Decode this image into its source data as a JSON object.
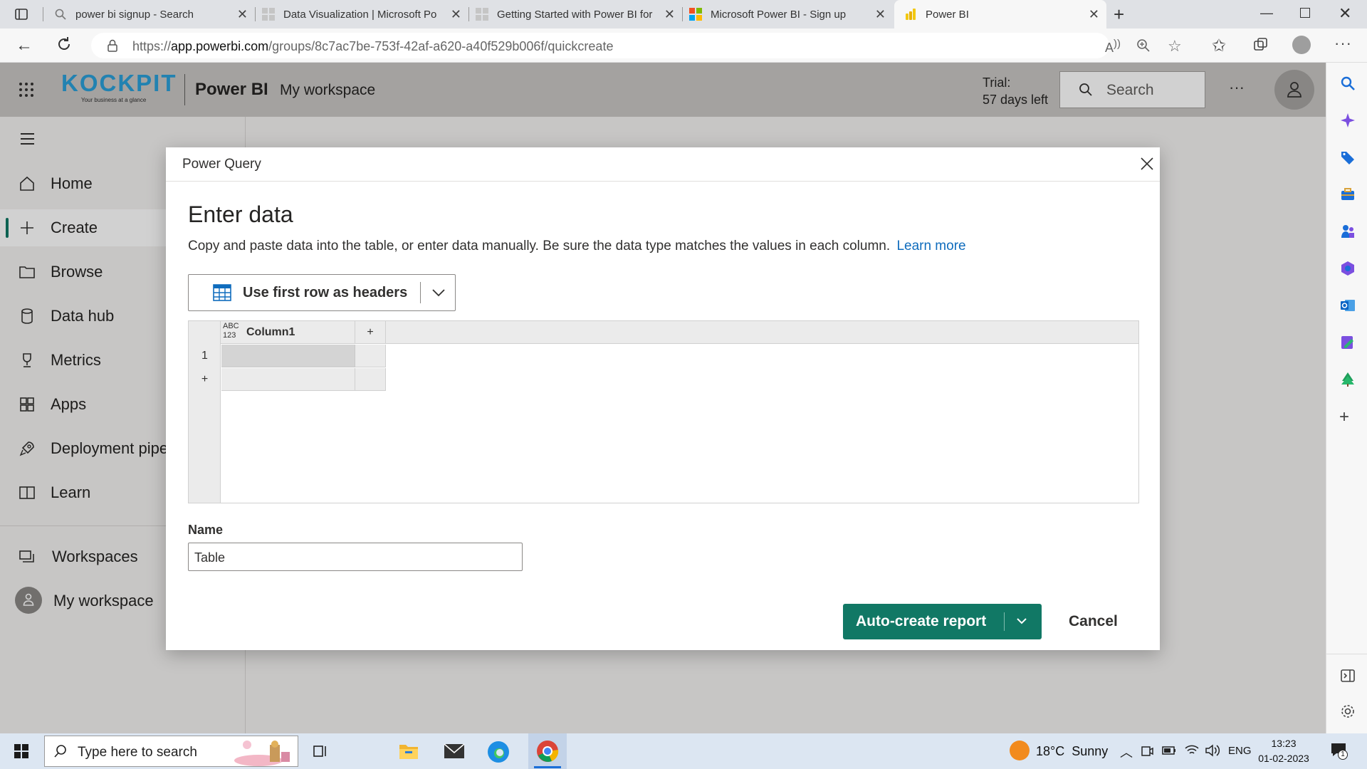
{
  "browser": {
    "tabs": [
      {
        "title": "power bi signup - Search",
        "icon": "search-icon",
        "active": false
      },
      {
        "title": "Data Visualization | Microsoft Po",
        "icon": "microsoft-logo-icon",
        "active": false
      },
      {
        "title": "Getting Started with Power BI for",
        "icon": "microsoft-logo-icon",
        "active": false
      },
      {
        "title": "Microsoft Power BI - Sign up",
        "icon": "microsoft-logo-icon",
        "active": false
      },
      {
        "title": "Power BI",
        "icon": "power-bi-icon",
        "active": true
      }
    ],
    "url_base": "https://",
    "url_domain": "app.powerbi.com",
    "url_path": "/groups/8c7ac7be-753f-42af-a620-a40f529b006f/quickcreate"
  },
  "header": {
    "logo_text": "KOCKPIT",
    "logo_tagline": "Your business at a glance",
    "app_name": "Power BI",
    "workspace": "My workspace",
    "trial_line1": "Trial:",
    "trial_line2": "57 days left",
    "search_placeholder": "Search",
    "more": "···"
  },
  "sidebar": {
    "items": [
      {
        "label": "Home",
        "icon": "home-icon"
      },
      {
        "label": "Create",
        "icon": "plus-icon",
        "selected": true
      },
      {
        "label": "Browse",
        "icon": "folder-icon"
      },
      {
        "label": "Data hub",
        "icon": "database-icon"
      },
      {
        "label": "Metrics",
        "icon": "trophy-icon"
      },
      {
        "label": "Apps",
        "icon": "apps-icon"
      },
      {
        "label": "Deployment pipe",
        "icon": "rocket-icon"
      },
      {
        "label": "Learn",
        "icon": "book-icon"
      }
    ],
    "workspaces": "Workspaces",
    "my_workspace": "My workspace"
  },
  "dialog": {
    "title": "Power Query",
    "heading": "Enter data",
    "description": "Copy and paste data into the table, or enter data manually. Be sure the data type matches the values in each column.",
    "learn_more": "Learn more",
    "header_option": "Use first row as headers",
    "table": {
      "type_badge_top": "ABC",
      "type_badge_bottom": "123",
      "columns": [
        "Column1"
      ],
      "add_column": "+",
      "rows": [
        {
          "num": "1",
          "cells": [
            ""
          ]
        }
      ],
      "add_row": "+"
    },
    "name_label": "Name",
    "name_value": "Table",
    "primary_button": "Auto-create report",
    "cancel_button": "Cancel"
  },
  "taskbar": {
    "search_placeholder": "Type here to search",
    "weather": "18°C  Sunny",
    "language": "ENG",
    "time": "13:23",
    "date": "01-02-2023",
    "notification_count": "1"
  },
  "colors": {
    "accent": "#117865",
    "link": "#0f6cbd",
    "header_bg": "#c8c6c4"
  }
}
